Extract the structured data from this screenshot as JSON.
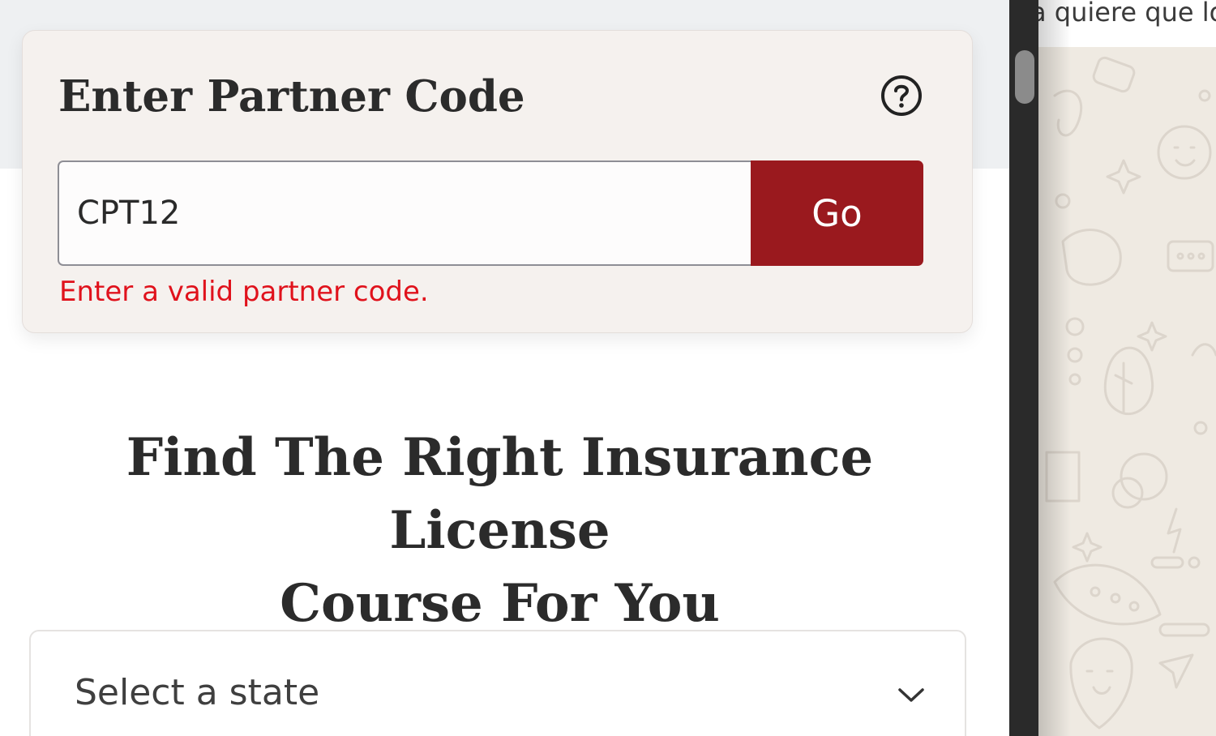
{
  "partner_code": {
    "title": "Enter Partner Code",
    "input_value": "CPT12",
    "go_label": "Go",
    "error": "Enter a valid partner code."
  },
  "headline": {
    "line1": "Find The Right Insurance License",
    "line2": "Course For You"
  },
  "state_select": {
    "selected": "Select a state"
  },
  "chat_window": {
    "snippet": "a quiere que lo"
  },
  "colors": {
    "go_button": "#9a191e",
    "error": "#e0121c",
    "card_bg": "#f5f1ee",
    "heading": "#2b2b2b"
  },
  "icons": {
    "help": "question-circle-icon",
    "dropdown": "chevron-down-icon"
  }
}
